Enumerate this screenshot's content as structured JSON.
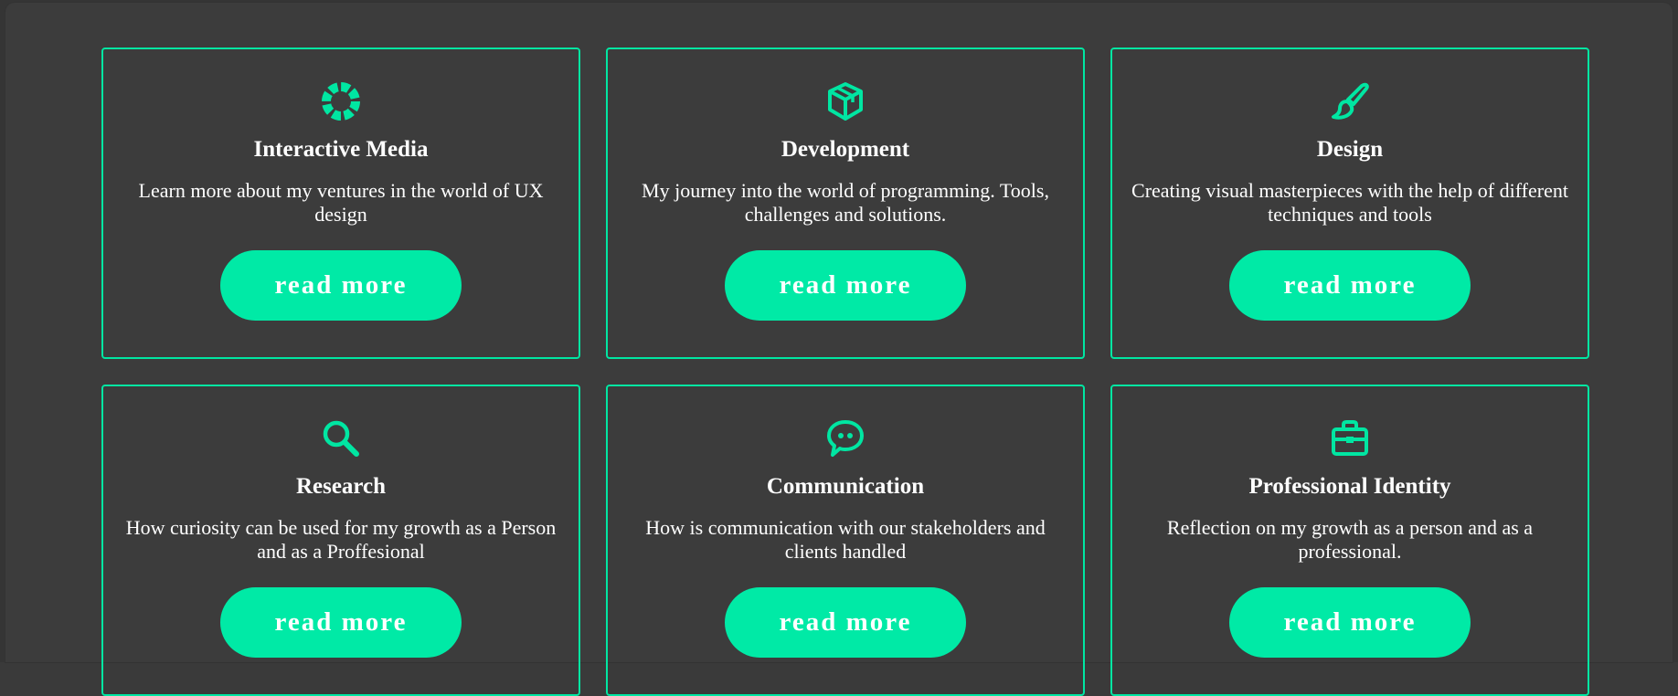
{
  "accent_color": "#00e6a2",
  "background_color": "#3c3c3c",
  "cards": [
    {
      "icon": "life-ring-icon",
      "title": "Interactive Media",
      "description": "Learn more about my ventures in the world of UX design",
      "button_label": "read more"
    },
    {
      "icon": "box-icon",
      "title": "Development",
      "description": "My journey into the world of programming. Tools, challenges and solutions.",
      "button_label": "read more"
    },
    {
      "icon": "paint-brush-icon",
      "title": "Design",
      "description": "Creating visual masterpieces with the help of different techniques and tools",
      "button_label": "read more"
    },
    {
      "icon": "magnifier-icon",
      "title": "Research",
      "description": "How curiosity can be used for my growth as a Person and as a Proffesional",
      "button_label": "read more"
    },
    {
      "icon": "chat-bubble-icon",
      "title": "Communication",
      "description": "How is communication with our stakeholders and clients handled",
      "button_label": "read more"
    },
    {
      "icon": "briefcase-icon",
      "title": "Professional Identity",
      "description": "Reflection on my growth as a person and as a professional.",
      "button_label": "read more"
    }
  ]
}
